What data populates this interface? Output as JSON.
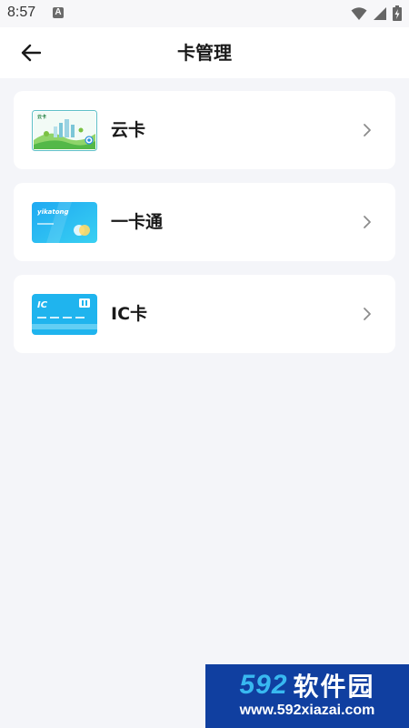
{
  "status_bar": {
    "time": "8:57",
    "notification_badge": "A",
    "icons": [
      "wifi-icon",
      "signal-icon",
      "battery-charging-icon"
    ]
  },
  "header": {
    "title": "卡管理",
    "back_icon": "arrow-left-icon"
  },
  "cards": [
    {
      "label": "云卡",
      "thumb_text": "云卡",
      "thumb_icon": "cloud-card-thumb"
    },
    {
      "label": "一卡通",
      "thumb_text": "yikatong",
      "thumb_icon": "yikatong-card-thumb"
    },
    {
      "label": "IC卡",
      "thumb_text": "IC",
      "thumb_icon": "ic-card-thumb"
    }
  ],
  "watermark": {
    "number": "592",
    "name": "软件园",
    "url": "www.592xiazai.com"
  },
  "colors": {
    "background": "#f4f5f9",
    "card_bg": "#ffffff",
    "title": "#1a1a1a",
    "chevron": "#8c8c8c",
    "watermark_bg": "#103fa0",
    "watermark_accent": "#38b8f0"
  }
}
